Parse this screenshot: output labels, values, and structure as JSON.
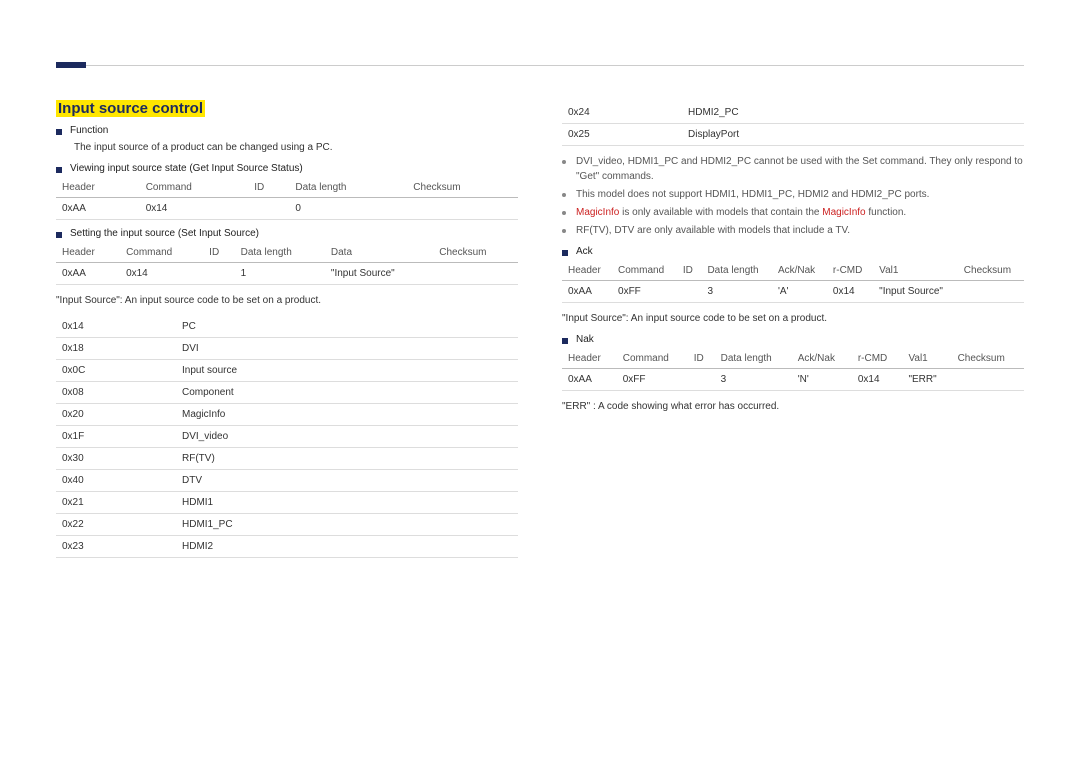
{
  "title": "Input source control",
  "left": {
    "function_label": "Function",
    "function_text": "The input source of a product can be changed using a PC.",
    "view_label": "Viewing input source state (Get Input Source Status)",
    "view_table": {
      "headers": [
        "Header",
        "Command",
        "ID",
        "Data length",
        "Checksum"
      ],
      "row": [
        "0xAA",
        "0x14",
        "",
        "0",
        ""
      ]
    },
    "set_label": "Setting the input source (Set Input Source)",
    "set_table": {
      "headers": [
        "Header",
        "Command",
        "ID",
        "Data length",
        "Data",
        "Checksum"
      ],
      "row": [
        "0xAA",
        "0x14",
        "",
        "1",
        "\"Input Source\"",
        ""
      ]
    },
    "codes_caption": "\"Input Source\": An input source code to be set on a product.",
    "codes": [
      [
        "0x14",
        "PC"
      ],
      [
        "0x18",
        "DVI"
      ],
      [
        "0x0C",
        "Input source"
      ],
      [
        "0x08",
        "Component"
      ],
      [
        "0x20",
        "MagicInfo"
      ],
      [
        "0x1F",
        "DVI_video"
      ],
      [
        "0x30",
        "RF(TV)"
      ],
      [
        "0x40",
        "DTV"
      ],
      [
        "0x21",
        "HDMI1"
      ],
      [
        "0x22",
        "HDMI1_PC"
      ],
      [
        "0x23",
        "HDMI2"
      ]
    ]
  },
  "right": {
    "codes_cont": [
      [
        "0x24",
        "HDMI2_PC"
      ],
      [
        "0x25",
        "DisplayPort"
      ]
    ],
    "notes": [
      {
        "pre": "DVI_video, HDMI1_PC and HDMI2_PC cannot be used with the Set command. They only respond to \"Get\" commands."
      },
      {
        "pre": "This model does not support HDMI1, HDMI1_PC, HDMI2 and HDMI2_PC ports."
      },
      {
        "pre_a": "MagicInfo",
        "mid": " is only available with models that contain the ",
        "pre_b": "MagicInfo",
        "post": " function."
      },
      {
        "pre": "RF(TV), DTV are only available with models that include a TV."
      }
    ],
    "ack_label": "Ack",
    "ack_table": {
      "headers": [
        "Header",
        "Command",
        "ID",
        "Data length",
        "Ack/Nak",
        "r-CMD",
        "Val1",
        "Checksum"
      ],
      "row": [
        "0xAA",
        "0xFF",
        "",
        "3",
        "'A'",
        "0x14",
        "\"Input Source\"",
        ""
      ]
    },
    "ack_caption": "\"Input Source\": An input source code to be set on a product.",
    "nak_label": "Nak",
    "nak_table": {
      "headers": [
        "Header",
        "Command",
        "ID",
        "Data length",
        "Ack/Nak",
        "r-CMD",
        "Val1",
        "Checksum"
      ],
      "row": [
        "0xAA",
        "0xFF",
        "",
        "3",
        "'N'",
        "0x14",
        "\"ERR\"",
        ""
      ]
    },
    "nak_caption": "\"ERR\" : A code showing what error has occurred."
  }
}
